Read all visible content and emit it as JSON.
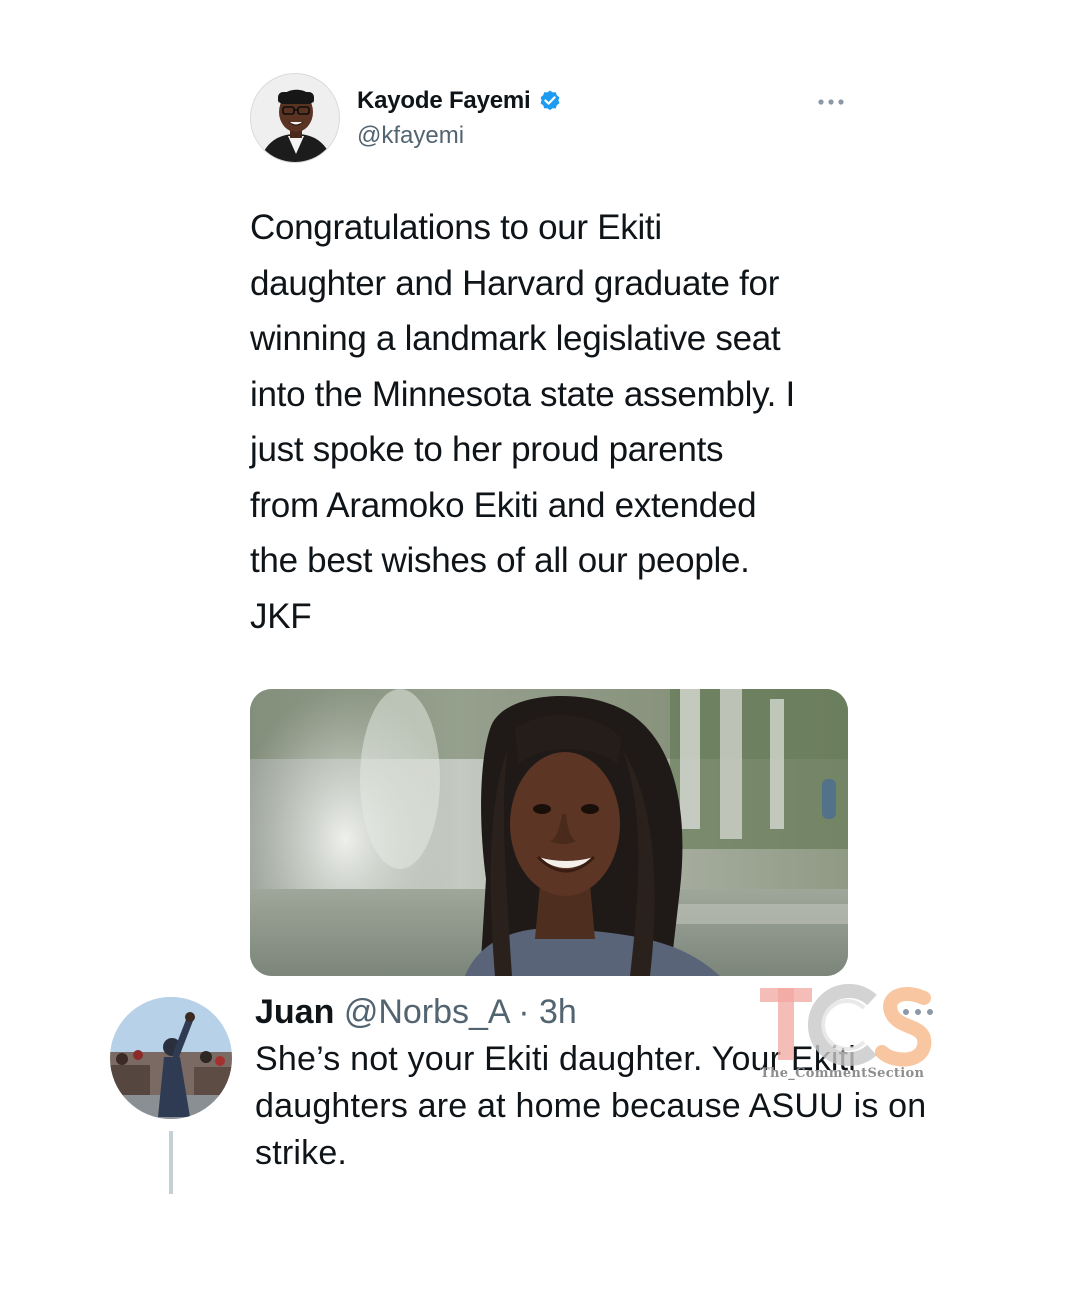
{
  "tweet": {
    "author": {
      "name": "Kayode Fayemi",
      "handle": "@kfayemi",
      "verified": true
    },
    "text": "Congratulations to our Ekiti\ndaughter and Harvard graduate for\nwinning a landmark legislative seat\ninto the Minnesota state assembly. I\njust spoke to her proud parents\nfrom Aramoko Ekiti and extended\nthe best wishes of all our people.\nJKF",
    "media": {
      "kind": "photo"
    }
  },
  "reply": {
    "name": "Juan",
    "handle": "@Norbs_A",
    "separator": "·",
    "time": "3h",
    "text": "She’s not your Ekiti daughter. Your Ekiti daughters are at home because ASUU is on strike."
  },
  "watermark": {
    "logo": "TCS",
    "caption": "The_CommentSection"
  },
  "icons": {
    "verified": "verified-badge-icon",
    "more": "more-options-icon"
  },
  "colors": {
    "text_primary": "#0f1419",
    "text_secondary": "#536471",
    "verified_blue": "#1d9bf0",
    "thread_line": "#c4cfd6",
    "watermark_red": "#f2a7a0",
    "watermark_gray": "#c8c8c8",
    "watermark_orange": "#f6b98a"
  }
}
